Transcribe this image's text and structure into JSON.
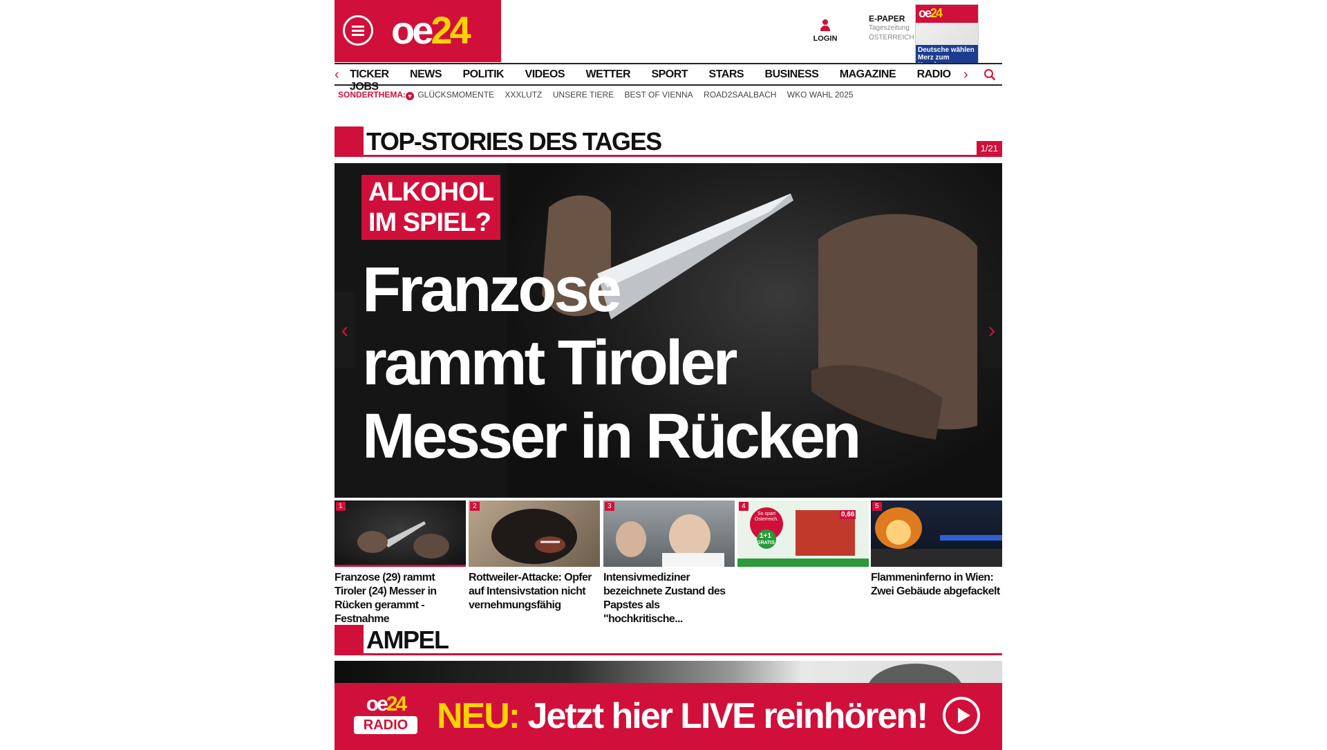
{
  "header": {
    "logo_text": "oe",
    "logo_accent": "24",
    "login_label": "LOGIN",
    "epaper_title": "E-PAPER",
    "epaper_sub1": "Tageszeitung",
    "epaper_sub2": "ÖSTERREICH",
    "epaper_cover_headline": "Deutsche wählen Merz zum Kanzler"
  },
  "nav": {
    "items": [
      "TICKER",
      "NEWS",
      "POLITIK",
      "VIDEOS",
      "WETTER",
      "SPORT",
      "STARS",
      "BUSINESS",
      "MAGAZINE",
      "RADIO",
      "JOBS"
    ]
  },
  "subnav": {
    "label": "SONDERTHEMA:",
    "items": [
      "GLÜCKSMOMENTE",
      "XXXLUTZ",
      "UNSERE TIERE",
      "BEST OF VIENNA",
      "ROAD2SAALBACH",
      "WKO WAHL 2025"
    ]
  },
  "top_stories": {
    "title": "TOP-STORIES DES TAGES",
    "counter": "1/21",
    "hero_kicker_line1": "ALKOHOL",
    "hero_kicker_line2": "IM SPIEL?",
    "hero_title_line1": "Franzose",
    "hero_title_line2": "rammt Tiroler",
    "hero_title_line3": "Messer in Rücken",
    "stories": [
      {
        "num": "1",
        "caption": "Franzose (29) rammt Tiroler (24) Messer in Rücken gerammt - Festnahme"
      },
      {
        "num": "2",
        "caption": "Rottweiler-Attacke: Opfer auf Intensivstation nicht vernehmungsfähig"
      },
      {
        "num": "3",
        "caption": "Intensivmediziner bezeichnete Zustand des Papstes als \"hochkritische..."
      },
      {
        "num": "4",
        "caption": ""
      },
      {
        "num": "5",
        "caption": "Flammeninferno in Wien: Zwei Gebäude abgefackelt"
      }
    ],
    "ad_texts": {
      "promo_badge": "1+1",
      "promo_sub": "GRATIS",
      "price": "0,66",
      "slogan": "So spart Österreich."
    }
  },
  "ampel": {
    "title": "AMPEL"
  },
  "radio_banner": {
    "logo_text": "oe",
    "logo_accent": "24",
    "logo_radio": "RADIO",
    "neu": "NEU:",
    "text": " Jetzt hier LIVE reinhören!"
  },
  "colors": {
    "brand": "#d0103a",
    "accent": "#ffd200"
  }
}
